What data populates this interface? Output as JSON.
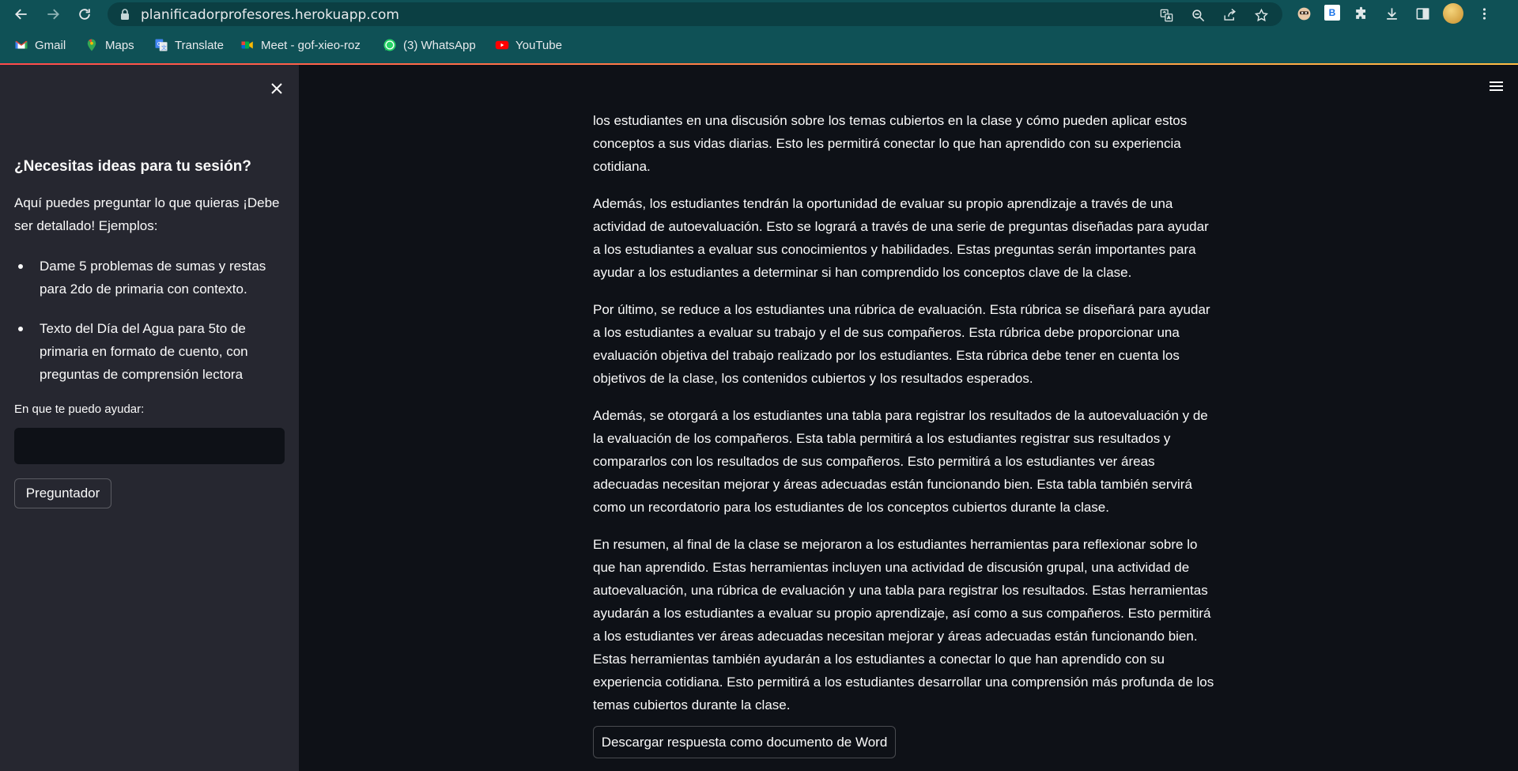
{
  "browser": {
    "url": "planificadorprofesores.herokuapp.com",
    "bookmarks": [
      {
        "label": "Gmail",
        "icon": "gmail-icon"
      },
      {
        "label": "Maps",
        "icon": "maps-icon"
      },
      {
        "label": "Translate",
        "icon": "translate-icon"
      },
      {
        "label": "Meet - gof-xieo-roz",
        "icon": "meet-icon"
      },
      {
        "label": "(3) WhatsApp",
        "icon": "whatsapp-icon"
      },
      {
        "label": "YouTube",
        "icon": "youtube-icon"
      }
    ],
    "extension_badge": "B"
  },
  "sidebar": {
    "title": "¿Necesitas ideas para tu sesión?",
    "intro": "Aquí puedes preguntar lo que quieras ¡Debe ser detallado! Ejemplos:",
    "examples": [
      "Dame 5 problemas de sumas y restas para 2do de primaria con contexto.",
      "Texto del Día del Agua para 5to de primaria en formato de cuento, con preguntas de comprensión lectora"
    ],
    "input_label": "En que te puedo ayudar:",
    "input_value": "",
    "button_label": "Preguntador"
  },
  "main": {
    "paragraphs": [
      "los estudiantes en una discusión sobre los temas cubiertos en la clase y cómo pueden aplicar estos conceptos a sus vidas diarias. Esto les permitirá conectar lo que han aprendido con su experiencia cotidiana.",
      "Además, los estudiantes tendrán la oportunidad de evaluar su propio aprendizaje a través de una actividad de autoevaluación. Esto se logrará a través de una serie de preguntas diseñadas para ayudar a los estudiantes a evaluar sus conocimientos y habilidades. Estas preguntas serán importantes para ayudar a los estudiantes a determinar si han comprendido los conceptos clave de la clase.",
      "Por último, se reduce a los estudiantes una rúbrica de evaluación. Esta rúbrica se diseñará para ayudar a los estudiantes a evaluar su trabajo y el de sus compañeros. Esta rúbrica debe proporcionar una evaluación objetiva del trabajo realizado por los estudiantes. Esta rúbrica debe tener en cuenta los objetivos de la clase, los contenidos cubiertos y los resultados esperados.",
      "Además, se otorgará a los estudiantes una tabla para registrar los resultados de la autoevaluación y de la evaluación de los compañeros. Esta tabla permitirá a los estudiantes registrar sus resultados y compararlos con los resultados de sus compañeros. Esto permitirá a los estudiantes ver áreas adecuadas necesitan mejorar y áreas adecuadas están funcionando bien. Esta tabla también servirá como un recordatorio para los estudiantes de los conceptos cubiertos durante la clase.",
      "En resumen, al final de la clase se mejoraron a los estudiantes herramientas para reflexionar sobre lo que han aprendido. Estas herramientas incluyen una actividad de discusión grupal, una actividad de autoevaluación, una rúbrica de evaluación y una tabla para registrar los resultados. Estas herramientas ayudarán a los estudiantes a evaluar su propio aprendizaje, así como a sus compañeros. Esto permitirá a los estudiantes ver áreas adecuadas necesitan mejorar y áreas adecuadas están funcionando bien. Estas herramientas también ayudarán a los estudiantes a conectar lo que han aprendido con su experiencia cotidiana. Esto permitirá a los estudiantes desarrollar una comprensión más profunda de los temas cubiertos durante la clase."
    ],
    "download_label": "Descargar respuesta como documento de Word"
  },
  "colors": {
    "chrome_bg": "#0f5156",
    "sidebar_bg": "#262730",
    "main_bg": "#0e1117",
    "text": "#fafafa"
  }
}
